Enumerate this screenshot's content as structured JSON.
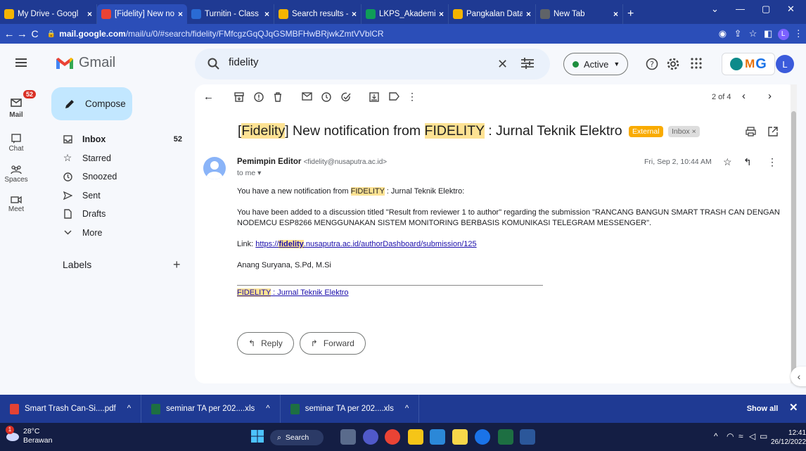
{
  "browser": {
    "tabs": [
      {
        "title": "My Drive - Googl",
        "color": "#f4b400",
        "active": false
      },
      {
        "title": "[Fidelity] New no",
        "color": "#ea4335",
        "active": true
      },
      {
        "title": "Turnitin - Class P",
        "color": "#2a6bd4",
        "active": false
      },
      {
        "title": "Search results - C",
        "color": "#f4b400",
        "active": false
      },
      {
        "title": "LKPS_Akademik_",
        "color": "#0f9d58",
        "active": false
      },
      {
        "title": "Pangkalan Data I",
        "color": "#f4b400",
        "active": false
      },
      {
        "title": "New Tab",
        "color": "#5f6368",
        "active": false
      }
    ],
    "tab_close": "×",
    "new_tab": "+",
    "url_host": "mail.google.com",
    "url_path": "/mail/u/0/#search/fidelity/FMfcgzGqQJqGSMBFHwBRjwkZmtVVblCR",
    "profile_initial": "L"
  },
  "gmail": {
    "app_name": "Gmail",
    "search_value": "fidelity",
    "status": "Active",
    "brand_text": [
      "M",
      "G"
    ],
    "avatar_initial": "L",
    "rail": [
      {
        "label": "Mail",
        "badge": "52",
        "icon": "mail-icon"
      },
      {
        "label": "Chat",
        "icon": "chat-icon"
      },
      {
        "label": "Spaces",
        "icon": "spaces-icon"
      },
      {
        "label": "Meet",
        "icon": "meet-icon"
      }
    ],
    "compose": "Compose",
    "nav": [
      {
        "label": "Inbox",
        "count": "52",
        "icon": "inbox-icon",
        "bold": true
      },
      {
        "label": "Starred",
        "icon": "star-icon"
      },
      {
        "label": "Snoozed",
        "icon": "clock-icon"
      },
      {
        "label": "Sent",
        "icon": "send-icon"
      },
      {
        "label": "Drafts",
        "icon": "draft-icon"
      },
      {
        "label": "More",
        "icon": "chevron-down-icon"
      }
    ],
    "labels_title": "Labels",
    "labels_add": "+"
  },
  "email": {
    "pager": "2 of 4",
    "subject_parts": {
      "open_bracket": "[",
      "tag1": "Fidelity",
      "mid": "] New notification from ",
      "tag2": "FIDELITY",
      "rest": " : Jurnal Teknik Elektro"
    },
    "label_external": "External",
    "label_inbox": "Inbox ×",
    "sender_name": "Pemimpin Editor",
    "sender_email": "<fidelity@nusaputra.ac.id>",
    "to": "to me ▾",
    "date": "Fri, Sep 2, 10:44 AM",
    "line1_pre": "You have a new notification from ",
    "line1_hl": "FIDELITY",
    "line1_post": " : Jurnal Teknik Elektro:",
    "paragraph": "You have been added to a discussion titled \"Result from reviewer 1 to author\" regarding the submission \"RANCANG BANGUN SMART TRASH CAN DENGAN NODEMCU ESP8266 MENGGUNAKAN SISTEM MONITORING BERBASIS KOMUNIKASI TELEGRAM MESSENGER\".",
    "link_label": "Link: ",
    "link_pre": "https://",
    "link_hl": "fidelity",
    "link_post": ".nusaputra.ac.id/authorDashboard/submission/125",
    "signature": "Anang Suryana, S.Pd, M.Si",
    "footer_hl": "FIDELITY",
    "footer_post": " : Jurnal Teknik Elektro",
    "reply": "Reply",
    "forward": "Forward"
  },
  "downloads": [
    {
      "name": "Smart Trash Can-Si....pdf",
      "color": "#e34234",
      "glyph": ""
    },
    {
      "name": "seminar TA per 202....xls",
      "color": "#1d6f42",
      "glyph": ""
    },
    {
      "name": "seminar TA per 202....xls",
      "color": "#1d6f42",
      "glyph": ""
    }
  ],
  "downloads_chevron": "^",
  "show_all": "Show all",
  "taskbar": {
    "temp": "28°C",
    "weather": "Berawan",
    "weather_badge": "1",
    "search": "Search",
    "time": "12:41",
    "date": "26/12/2022"
  }
}
